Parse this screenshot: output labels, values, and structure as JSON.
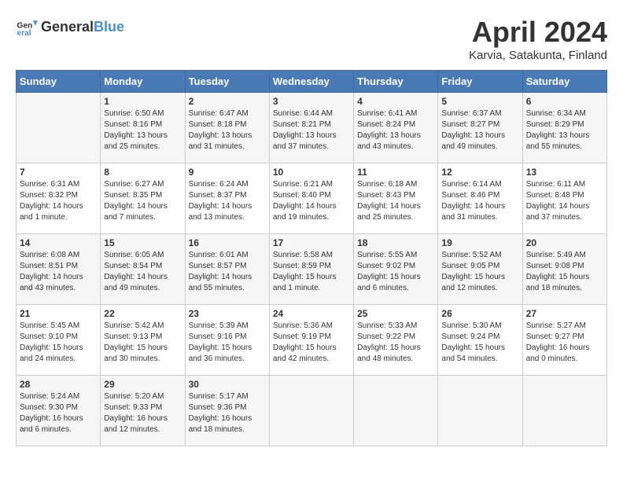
{
  "header": {
    "logo_general": "General",
    "logo_blue": "Blue",
    "month": "April 2024",
    "location": "Karvia, Satakunta, Finland"
  },
  "days_of_week": [
    "Sunday",
    "Monday",
    "Tuesday",
    "Wednesday",
    "Thursday",
    "Friday",
    "Saturday"
  ],
  "weeks": [
    [
      {
        "day": "",
        "info": ""
      },
      {
        "day": "1",
        "info": "Sunrise: 6:50 AM\nSunset: 8:16 PM\nDaylight: 13 hours\nand 25 minutes."
      },
      {
        "day": "2",
        "info": "Sunrise: 6:47 AM\nSunset: 8:18 PM\nDaylight: 13 hours\nand 31 minutes."
      },
      {
        "day": "3",
        "info": "Sunrise: 6:44 AM\nSunset: 8:21 PM\nDaylight: 13 hours\nand 37 minutes."
      },
      {
        "day": "4",
        "info": "Sunrise: 6:41 AM\nSunset: 8:24 PM\nDaylight: 13 hours\nand 43 minutes."
      },
      {
        "day": "5",
        "info": "Sunrise: 6:37 AM\nSunset: 8:27 PM\nDaylight: 13 hours\nand 49 minutes."
      },
      {
        "day": "6",
        "info": "Sunrise: 6:34 AM\nSunset: 8:29 PM\nDaylight: 13 hours\nand 55 minutes."
      }
    ],
    [
      {
        "day": "7",
        "info": "Sunrise: 6:31 AM\nSunset: 8:32 PM\nDaylight: 14 hours\nand 1 minute."
      },
      {
        "day": "8",
        "info": "Sunrise: 6:27 AM\nSunset: 8:35 PM\nDaylight: 14 hours\nand 7 minutes."
      },
      {
        "day": "9",
        "info": "Sunrise: 6:24 AM\nSunset: 8:37 PM\nDaylight: 14 hours\nand 13 minutes."
      },
      {
        "day": "10",
        "info": "Sunrise: 6:21 AM\nSunset: 8:40 PM\nDaylight: 14 hours\nand 19 minutes."
      },
      {
        "day": "11",
        "info": "Sunrise: 6:18 AM\nSunset: 8:43 PM\nDaylight: 14 hours\nand 25 minutes."
      },
      {
        "day": "12",
        "info": "Sunrise: 6:14 AM\nSunset: 8:46 PM\nDaylight: 14 hours\nand 31 minutes."
      },
      {
        "day": "13",
        "info": "Sunrise: 6:11 AM\nSunset: 8:48 PM\nDaylight: 14 hours\nand 37 minutes."
      }
    ],
    [
      {
        "day": "14",
        "info": "Sunrise: 6:08 AM\nSunset: 8:51 PM\nDaylight: 14 hours\nand 43 minutes."
      },
      {
        "day": "15",
        "info": "Sunrise: 6:05 AM\nSunset: 8:54 PM\nDaylight: 14 hours\nand 49 minutes."
      },
      {
        "day": "16",
        "info": "Sunrise: 6:01 AM\nSunset: 8:57 PM\nDaylight: 14 hours\nand 55 minutes."
      },
      {
        "day": "17",
        "info": "Sunrise: 5:58 AM\nSunset: 8:59 PM\nDaylight: 15 hours\nand 1 minute."
      },
      {
        "day": "18",
        "info": "Sunrise: 5:55 AM\nSunset: 9:02 PM\nDaylight: 15 hours\nand 6 minutes."
      },
      {
        "day": "19",
        "info": "Sunrise: 5:52 AM\nSunset: 9:05 PM\nDaylight: 15 hours\nand 12 minutes."
      },
      {
        "day": "20",
        "info": "Sunrise: 5:49 AM\nSunset: 9:08 PM\nDaylight: 15 hours\nand 18 minutes."
      }
    ],
    [
      {
        "day": "21",
        "info": "Sunrise: 5:45 AM\nSunset: 9:10 PM\nDaylight: 15 hours\nand 24 minutes."
      },
      {
        "day": "22",
        "info": "Sunrise: 5:42 AM\nSunset: 9:13 PM\nDaylight: 15 hours\nand 30 minutes."
      },
      {
        "day": "23",
        "info": "Sunrise: 5:39 AM\nSunset: 9:16 PM\nDaylight: 15 hours\nand 36 minutes."
      },
      {
        "day": "24",
        "info": "Sunrise: 5:36 AM\nSunset: 9:19 PM\nDaylight: 15 hours\nand 42 minutes."
      },
      {
        "day": "25",
        "info": "Sunrise: 5:33 AM\nSunset: 9:22 PM\nDaylight: 15 hours\nand 48 minutes."
      },
      {
        "day": "26",
        "info": "Sunrise: 5:30 AM\nSunset: 9:24 PM\nDaylight: 15 hours\nand 54 minutes."
      },
      {
        "day": "27",
        "info": "Sunrise: 5:27 AM\nSunset: 9:27 PM\nDaylight: 16 hours\nand 0 minutes."
      }
    ],
    [
      {
        "day": "28",
        "info": "Sunrise: 5:24 AM\nSunset: 9:30 PM\nDaylight: 16 hours\nand 6 minutes."
      },
      {
        "day": "29",
        "info": "Sunrise: 5:20 AM\nSunset: 9:33 PM\nDaylight: 16 hours\nand 12 minutes."
      },
      {
        "day": "30",
        "info": "Sunrise: 5:17 AM\nSunset: 9:36 PM\nDaylight: 16 hours\nand 18 minutes."
      },
      {
        "day": "",
        "info": ""
      },
      {
        "day": "",
        "info": ""
      },
      {
        "day": "",
        "info": ""
      },
      {
        "day": "",
        "info": ""
      }
    ]
  ]
}
